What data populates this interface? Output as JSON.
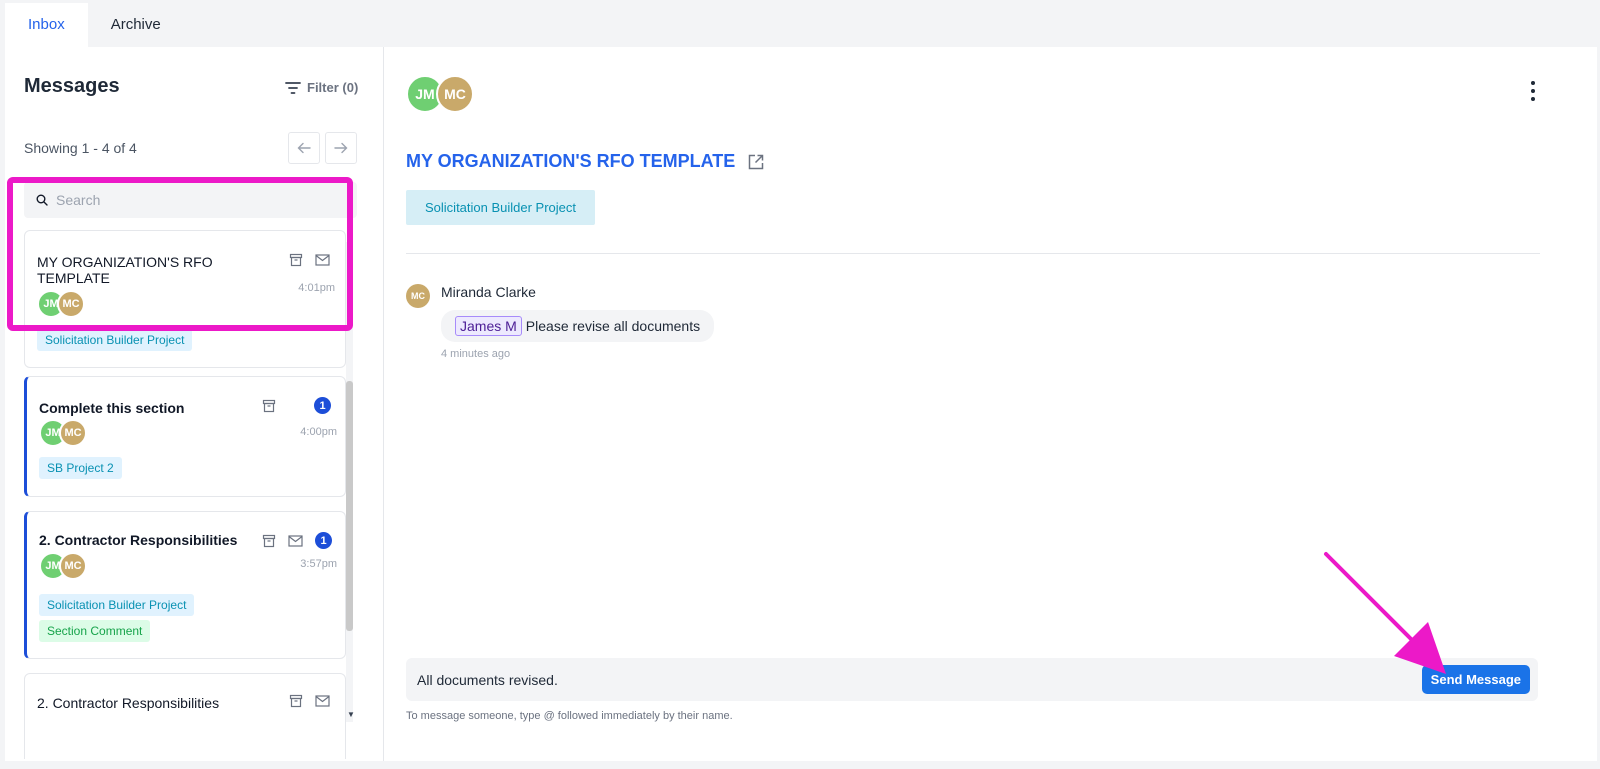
{
  "tabs": [
    {
      "label": "Inbox",
      "active": true
    },
    {
      "label": "Archive",
      "active": false
    }
  ],
  "sidebar": {
    "title": "Messages",
    "filter_label": "Filter (0)",
    "showing": "Showing 1 - 4 of 4",
    "search_placeholder": "Search",
    "items": [
      {
        "title": "MY ORGANIZATION'S RFO TEMPLATE",
        "time": "4:01pm",
        "avatars": [
          "JM",
          "MC"
        ],
        "tags": [
          "Solicitation Builder Project"
        ],
        "unread": null,
        "selected": true
      },
      {
        "title": "Complete this section",
        "time": "4:00pm",
        "avatars": [
          "JM",
          "MC"
        ],
        "tags": [
          "SB Project 2"
        ],
        "unread": "1",
        "selected": false
      },
      {
        "title": "2. Contractor Responsibilities",
        "time": "3:57pm",
        "avatars": [
          "JM",
          "MC"
        ],
        "tags": [
          "Solicitation Builder Project",
          "Section Comment"
        ],
        "unread": "1",
        "selected": false
      },
      {
        "title": "2. Contractor Responsibilities",
        "time": "",
        "avatars": [],
        "tags": [],
        "unread": null,
        "selected": false
      }
    ]
  },
  "conversation": {
    "avatars": [
      "JM",
      "MC"
    ],
    "title": "MY ORGANIZATION'S RFO TEMPLATE",
    "tag": "Solicitation Builder Project",
    "messages": [
      {
        "author_initials": "MC",
        "author": "Miranda Clarke",
        "mention": "James M",
        "text": "Please revise all documents",
        "time": "4 minutes ago"
      }
    ],
    "composer_value": "All documents revised.",
    "send_label": "Send Message",
    "hint": "To message someone, type @ followed immediately by their name."
  },
  "colors": {
    "accent": "#2563eb",
    "send_button": "#1a73e8",
    "highlight_annotation": "#ec19c8",
    "unread_badge": "#1d4ed8",
    "avatar_jm": "#6fcf72",
    "avatar_mc": "#c9a96a"
  },
  "icons": [
    "filter-icon",
    "arrow-left-icon",
    "arrow-right-icon",
    "search-icon",
    "archive-icon",
    "envelope-icon",
    "external-link-icon",
    "more-vertical-icon"
  ]
}
